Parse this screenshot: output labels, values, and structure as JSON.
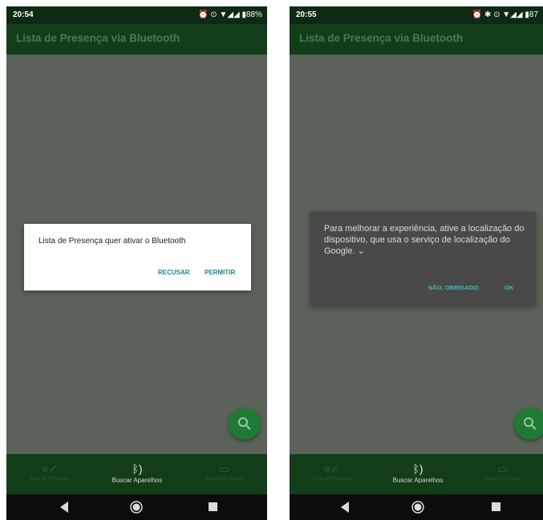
{
  "screen1": {
    "status": {
      "time": "20:54",
      "icons": "⏰ ⊙ ▼◢◢ ▮88%"
    },
    "app_title": "Lista de Presença via Bluetooth",
    "dialog": {
      "message": "Lista de Presença quer ativar o Bluetooth",
      "deny": "RECUSAR",
      "allow": "PERMITIR"
    },
    "nav": {
      "item1": "Lista de Presença",
      "item2": "Buscar Aparelhos",
      "item3": "Aparelhos Salvos"
    }
  },
  "screen2": {
    "status": {
      "time": "20:55",
      "icons": "⏰ ✱ ⊙ ▼◢◢ ▮87"
    },
    "app_title": "Lista de Presença via Bluetooth",
    "dialog": {
      "message": "Para melhorar a experiência, ative a localização do dispositivo, que usa o serviço de localização do Google. ⌄",
      "deny": "NÃO, OBRIGADO.",
      "ok": "OK"
    },
    "nav": {
      "item1": "Lista de Presença",
      "item2": "Buscar Aparelhos",
      "item3": "Aparelhos Salvos"
    }
  },
  "icons": [
    "search-icon",
    "list-check-icon",
    "bluetooth-search-icon",
    "saved-devices-icon",
    "back-icon",
    "home-icon",
    "recents-icon"
  ],
  "colors": {
    "app_bar": "#123d19",
    "fab": "#1f7a33",
    "accent": "#1a8a8a",
    "scrim": "#5a6259"
  }
}
